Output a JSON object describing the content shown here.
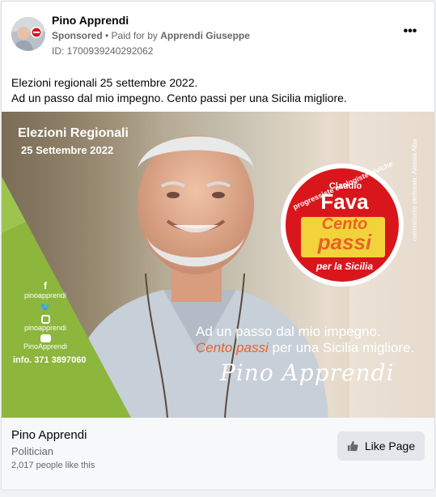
{
  "post": {
    "page_name": "Pino Apprendi",
    "sponsored": "Sponsored",
    "separator": " • ",
    "paid_for_prefix": "Paid for by ",
    "paid_for_name": "Apprendi Giuseppe",
    "ad_id": "ID: 1700939240292062",
    "text_line1": "Elezioni regionali 25 settembre 2022.",
    "text_line2": "Ad un passo dal mio impegno. Cento passi per una Sicilia migliore.",
    "more_icon": "more-options-icon"
  },
  "creative": {
    "title_line1": "Elezioni Regionali",
    "title_line2": "25 Settembre 2022",
    "side_note": "committente elettorale: Alessia Alba",
    "badge_arc": "progressiste ecologiste civiche",
    "badge_name_small": "Claudio",
    "badge_name": "Fava",
    "badge_cento": "Cento",
    "badge_passi": "passi",
    "badge_per": "per la Sicilia",
    "slogan_line1": "Ad un passo dal mio impegno.",
    "slogan_highlight": "Cento passi",
    "slogan_rest": " per una Sicilia migliore.",
    "signature": "Pino Apprendi",
    "socials": [
      {
        "icon": "facebook-icon",
        "label": "pinoapprendi"
      },
      {
        "icon": "twitter-icon",
        "label": ""
      },
      {
        "icon": "instagram-icon",
        "label": "pinoapprendi"
      },
      {
        "icon": "youtube-icon",
        "label": "PinoApprendi"
      }
    ],
    "info": "info. 371 3897060",
    "colors": {
      "green": "#8cb63c",
      "red": "#d9161c",
      "orange": "#e8622a",
      "yellow": "#f2d33b"
    }
  },
  "footer": {
    "page_name": "Pino Apprendi",
    "category": "Politician",
    "likes": "2,017 people like this",
    "like_button": "Like Page",
    "like_icon": "thumbs-up-icon"
  }
}
